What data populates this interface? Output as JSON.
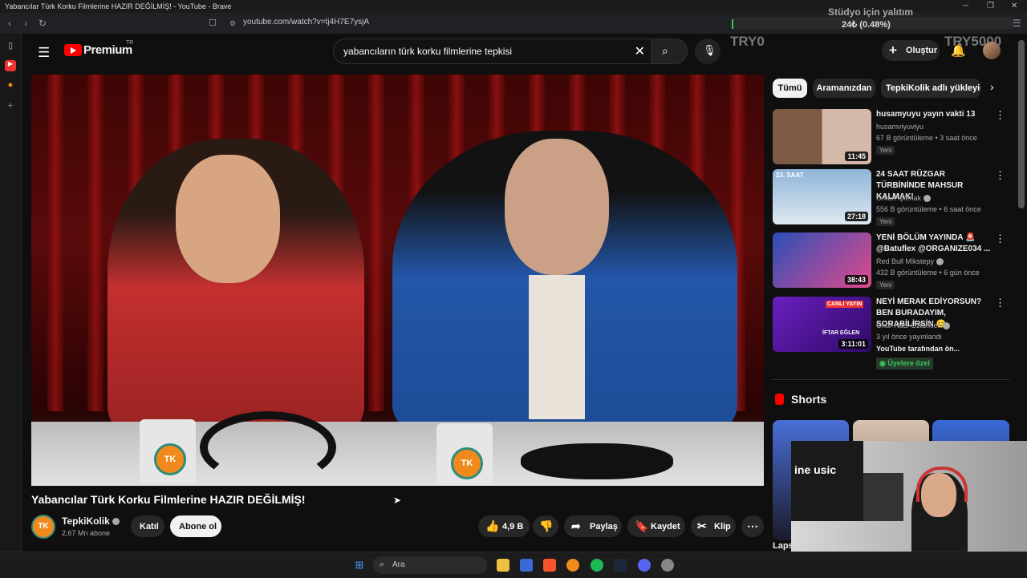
{
  "window": {
    "title": "Yabancılar Türk Korku Filmlerine HAZIR DEĞİLMİŞ! - YouTube - Brave",
    "controls": [
      "─",
      "❐",
      "✕"
    ]
  },
  "browser": {
    "url": "youtube.com/watch?v=tj4H7E7ysjA"
  },
  "stream_overlay": {
    "title": "Stüdyo için yalıtım",
    "value": "24₺ (0.48%)",
    "min_label": "TRY0",
    "max_label": "TRY5000",
    "progress_fraction": 0.0048
  },
  "header": {
    "logo_text": "Premium",
    "region": "TR",
    "search_query": "yabancıların türk korku filmlerine tepkisi",
    "create_label": "Oluştur"
  },
  "video": {
    "title": "Yabancılar Türk Korku Filmlerine HAZIR DEĞİLMİŞ!",
    "mug_logo": "TK",
    "channel_name": "TepkiKolik",
    "channel_avatar_text": "TK",
    "subscribers": "2,67 Mn abone",
    "join_label": "Katıl",
    "subscribe_label": "Abone ol",
    "likes": "4,9 B",
    "share_label": "Paylaş",
    "save_label": "Kaydet",
    "clip_label": "Klip"
  },
  "filters": [
    {
      "label": "Tümü"
    },
    {
      "label": "Aramanızdan"
    },
    {
      "label": "TepkiKolik adlı yükleyici"
    }
  ],
  "recommendations": [
    {
      "title": "husamyuyu yayın vakti 13",
      "channel": "husamviyuviyu",
      "meta": "67 B görüntüleme • 3 saat önce",
      "duration": "11:45",
      "badge": "Yeni"
    },
    {
      "title": "24 SAAT RÜZGAR TÜRBİNİNDE MAHSUR KALMAK!",
      "channel": "Orkun Işıtmak",
      "meta": "556 B görüntüleme • 6 saat önce",
      "duration": "27:18",
      "badge": "Yeni",
      "thumb_text": "23. SAAT"
    },
    {
      "title": "YENİ BÖLÜM YAYINDA 🚨 @Batuflex @ORGANIZE034 ...",
      "channel": "Red Bull Mikstepy",
      "meta": "432 B görüntüleme • 6 gün önce",
      "duration": "38:43",
      "badge": "Yeni"
    },
    {
      "title": "NEYİ MERAK EDİYORSUN? BEN BURADAYIM, SORABİLİRSİN 😊",
      "channel": "Onur Naci Öztürkler",
      "meta": "3 yıl önce yayınlandı",
      "duration": "3:11:01",
      "extra": "YouTube tarafından ön...",
      "member": "Üyelere özel",
      "thumb_text1": "CANLI YAYIN",
      "thumb_text2": "İFTAR EĞLEN"
    }
  ],
  "shorts": {
    "title": "Shorts",
    "partial_label": "Laps"
  },
  "webcam": {
    "monitor_text": "ine usic"
  },
  "taskbar": {
    "search_label": "Ara"
  }
}
